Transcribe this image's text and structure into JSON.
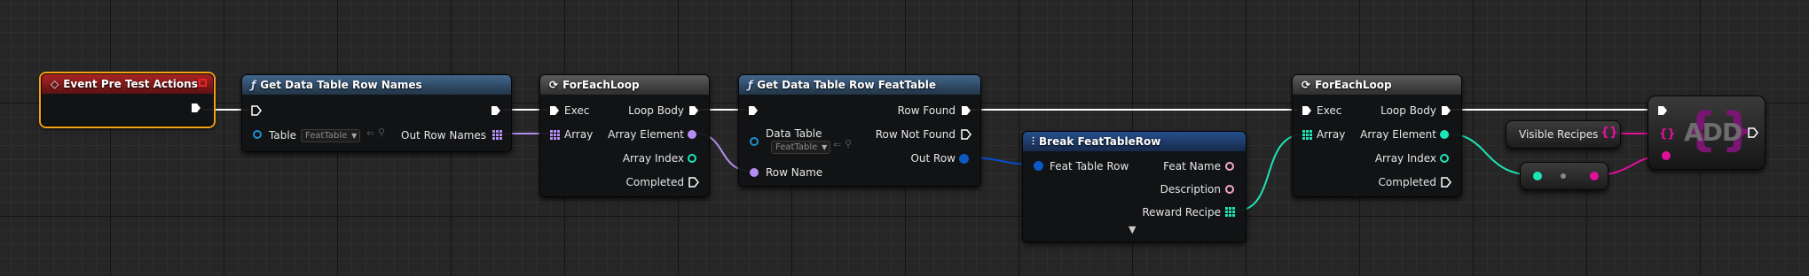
{
  "event_node": {
    "title": "Event Pre Test Actions"
  },
  "get_row_names": {
    "title": "Get Data Table Row Names",
    "table_label": "Table",
    "table_value": "FeatTable",
    "out_label": "Out Row Names"
  },
  "foreach1": {
    "title": "ForEachLoop",
    "exec_label": "Exec",
    "array_label": "Array",
    "loop_body_label": "Loop Body",
    "array_element_label": "Array Element",
    "array_index_label": "Array Index",
    "completed_label": "Completed"
  },
  "get_row": {
    "title": "Get Data Table Row FeatTable",
    "data_table_label": "Data Table",
    "data_table_value": "FeatTable",
    "row_name_label": "Row Name",
    "row_found_label": "Row Found",
    "row_not_found_label": "Row Not Found",
    "out_row_label": "Out Row"
  },
  "break_node": {
    "title": "Break FeatTableRow",
    "in_label": "Feat Table Row",
    "feat_name_label": "Feat Name",
    "description_label": "Description",
    "reward_recipe_label": "Reward Recipe"
  },
  "foreach2": {
    "title": "ForEachLoop",
    "exec_label": "Exec",
    "array_label": "Array",
    "loop_body_label": "Loop Body",
    "array_element_label": "Array Element",
    "array_index_label": "Array Index",
    "completed_label": "Completed"
  },
  "visible_recipes": {
    "label": "Visible Recipes"
  },
  "add_node": {
    "label": "ADD"
  },
  "colors": {
    "exec": "#ffffff",
    "struct": "#0a59c4",
    "set_pin": "#e1109b",
    "name_pin": "#c89bf0",
    "array_pin": "#1ce5b7",
    "event_header": "#a92324",
    "function_header": "#42668d",
    "selection": "#f4a017"
  }
}
